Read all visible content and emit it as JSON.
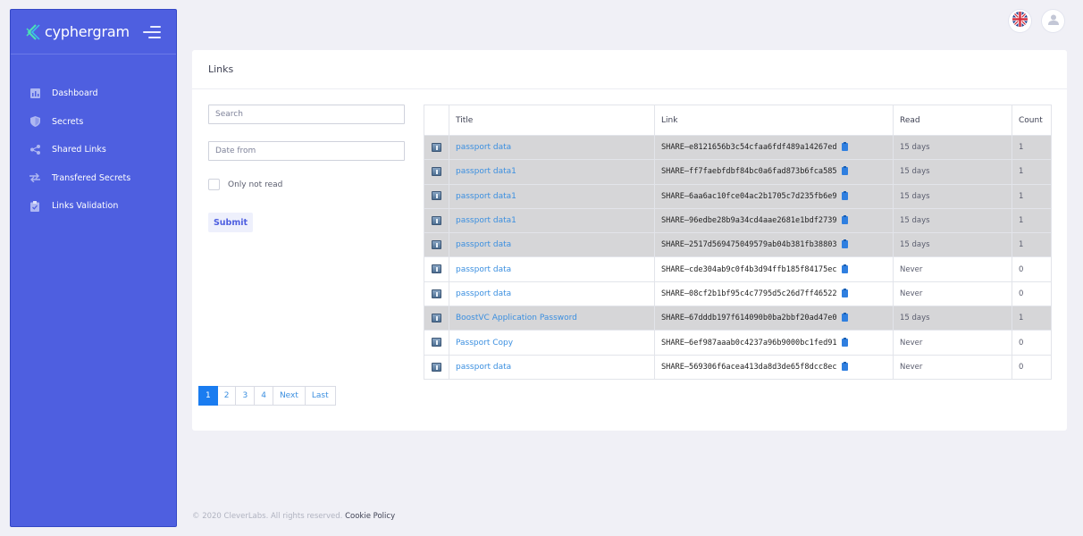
{
  "brand": {
    "name": "cyphergram"
  },
  "sidebar": {
    "items": [
      {
        "label": "Dashboard",
        "icon": "chart-icon"
      },
      {
        "label": "Secrets",
        "icon": "shield-icon"
      },
      {
        "label": "Shared Links",
        "icon": "share-icon"
      },
      {
        "label": "Transfered Secrets",
        "icon": "transfer-arrows-icon"
      },
      {
        "label": "Links Validation",
        "icon": "clipboard-check-icon"
      }
    ]
  },
  "card": {
    "title": "Links"
  },
  "filters": {
    "search_placeholder": "Search",
    "date_placeholder": "Date from",
    "only_not_read_label": "Only not read",
    "submit_label": "Submit"
  },
  "table": {
    "headers": [
      "Title",
      "Link",
      "Read",
      "Count"
    ],
    "rows": [
      {
        "title": "passport data",
        "link": "SHARE—e8121656b3c54cfaa6fdf489a14267ed",
        "read": "15 days",
        "count": "1",
        "shade": "gray"
      },
      {
        "title": "passport data1",
        "link": "SHARE—ff7faebfdbf84bc0a6fad873b6fca585",
        "read": "15 days",
        "count": "1",
        "shade": "gray"
      },
      {
        "title": "passport data1",
        "link": "SHARE—6aa6ac10fce04ac2b1705c7d235fb6e9",
        "read": "15 days",
        "count": "1",
        "shade": "gray"
      },
      {
        "title": "passport data1",
        "link": "SHARE—96edbe28b9a34cd4aae2681e1bdf2739",
        "read": "15 days",
        "count": "1",
        "shade": "gray"
      },
      {
        "title": "passport data",
        "link": "SHARE—2517d569475049579ab04b381fb38803",
        "read": "15 days",
        "count": "1",
        "shade": "gray"
      },
      {
        "title": "passport data",
        "link": "SHARE—cde304ab9c0f4b3d94ffb185f84175ec",
        "read": "Never",
        "count": "0",
        "shade": "white"
      },
      {
        "title": "passport data",
        "link": "SHARE—08cf2b1bf95c4c7795d5c26d7ff46522",
        "read": "Never",
        "count": "0",
        "shade": "white"
      },
      {
        "title": "BoostVC Application Password",
        "link": "SHARE—67dddb197f614090b0ba2bbf20ad47e0",
        "read": "15 days",
        "count": "1",
        "shade": "gray"
      },
      {
        "title": "Passport Copy",
        "link": "SHARE—6ef987aaab0c4237a96b9000bc1fed91",
        "read": "Never",
        "count": "0",
        "shade": "white"
      },
      {
        "title": "passport data",
        "link": "SHARE—569306f6acea413da8d3de65f8dcc8ec",
        "read": "Never",
        "count": "0",
        "shade": "white"
      }
    ]
  },
  "pagination": [
    "1",
    "2",
    "3",
    "4",
    "Next",
    "Last"
  ],
  "pagination_active": "1",
  "footer": {
    "copyright": "© 2020 CleverLabs. All rights reserved.",
    "cookie_link": "Cookie Policy"
  },
  "colors": {
    "sidebar": "#4e5fe0",
    "link": "#3b8fe0",
    "active_page": "#1a7cf0",
    "read_row": "#d6d6d8"
  }
}
